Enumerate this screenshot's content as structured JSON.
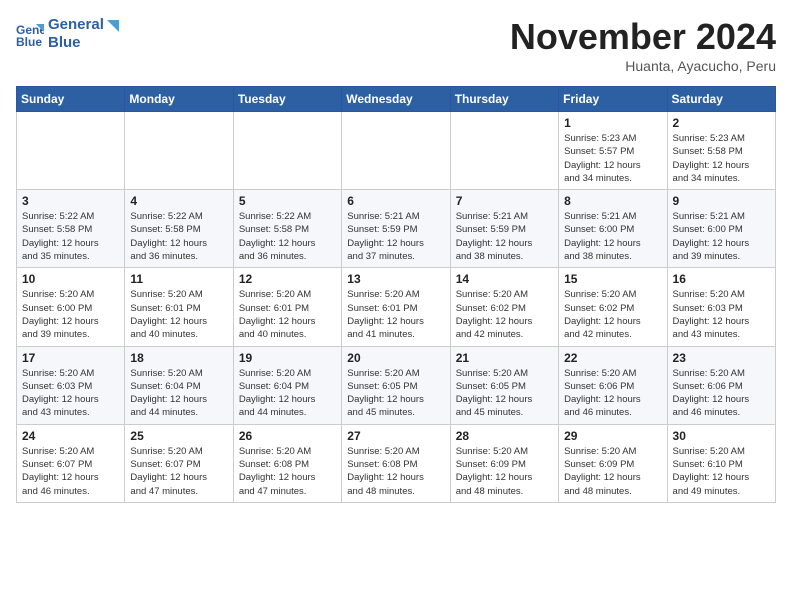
{
  "header": {
    "logo_line1": "General",
    "logo_line2": "Blue",
    "month_year": "November 2024",
    "location": "Huanta, Ayacucho, Peru"
  },
  "days_of_week": [
    "Sunday",
    "Monday",
    "Tuesday",
    "Wednesday",
    "Thursday",
    "Friday",
    "Saturday"
  ],
  "weeks": [
    [
      {
        "day": "",
        "info": ""
      },
      {
        "day": "",
        "info": ""
      },
      {
        "day": "",
        "info": ""
      },
      {
        "day": "",
        "info": ""
      },
      {
        "day": "",
        "info": ""
      },
      {
        "day": "1",
        "info": "Sunrise: 5:23 AM\nSunset: 5:57 PM\nDaylight: 12 hours\nand 34 minutes."
      },
      {
        "day": "2",
        "info": "Sunrise: 5:23 AM\nSunset: 5:58 PM\nDaylight: 12 hours\nand 34 minutes."
      }
    ],
    [
      {
        "day": "3",
        "info": "Sunrise: 5:22 AM\nSunset: 5:58 PM\nDaylight: 12 hours\nand 35 minutes."
      },
      {
        "day": "4",
        "info": "Sunrise: 5:22 AM\nSunset: 5:58 PM\nDaylight: 12 hours\nand 36 minutes."
      },
      {
        "day": "5",
        "info": "Sunrise: 5:22 AM\nSunset: 5:58 PM\nDaylight: 12 hours\nand 36 minutes."
      },
      {
        "day": "6",
        "info": "Sunrise: 5:21 AM\nSunset: 5:59 PM\nDaylight: 12 hours\nand 37 minutes."
      },
      {
        "day": "7",
        "info": "Sunrise: 5:21 AM\nSunset: 5:59 PM\nDaylight: 12 hours\nand 38 minutes."
      },
      {
        "day": "8",
        "info": "Sunrise: 5:21 AM\nSunset: 6:00 PM\nDaylight: 12 hours\nand 38 minutes."
      },
      {
        "day": "9",
        "info": "Sunrise: 5:21 AM\nSunset: 6:00 PM\nDaylight: 12 hours\nand 39 minutes."
      }
    ],
    [
      {
        "day": "10",
        "info": "Sunrise: 5:20 AM\nSunset: 6:00 PM\nDaylight: 12 hours\nand 39 minutes."
      },
      {
        "day": "11",
        "info": "Sunrise: 5:20 AM\nSunset: 6:01 PM\nDaylight: 12 hours\nand 40 minutes."
      },
      {
        "day": "12",
        "info": "Sunrise: 5:20 AM\nSunset: 6:01 PM\nDaylight: 12 hours\nand 40 minutes."
      },
      {
        "day": "13",
        "info": "Sunrise: 5:20 AM\nSunset: 6:01 PM\nDaylight: 12 hours\nand 41 minutes."
      },
      {
        "day": "14",
        "info": "Sunrise: 5:20 AM\nSunset: 6:02 PM\nDaylight: 12 hours\nand 42 minutes."
      },
      {
        "day": "15",
        "info": "Sunrise: 5:20 AM\nSunset: 6:02 PM\nDaylight: 12 hours\nand 42 minutes."
      },
      {
        "day": "16",
        "info": "Sunrise: 5:20 AM\nSunset: 6:03 PM\nDaylight: 12 hours\nand 43 minutes."
      }
    ],
    [
      {
        "day": "17",
        "info": "Sunrise: 5:20 AM\nSunset: 6:03 PM\nDaylight: 12 hours\nand 43 minutes."
      },
      {
        "day": "18",
        "info": "Sunrise: 5:20 AM\nSunset: 6:04 PM\nDaylight: 12 hours\nand 44 minutes."
      },
      {
        "day": "19",
        "info": "Sunrise: 5:20 AM\nSunset: 6:04 PM\nDaylight: 12 hours\nand 44 minutes."
      },
      {
        "day": "20",
        "info": "Sunrise: 5:20 AM\nSunset: 6:05 PM\nDaylight: 12 hours\nand 45 minutes."
      },
      {
        "day": "21",
        "info": "Sunrise: 5:20 AM\nSunset: 6:05 PM\nDaylight: 12 hours\nand 45 minutes."
      },
      {
        "day": "22",
        "info": "Sunrise: 5:20 AM\nSunset: 6:06 PM\nDaylight: 12 hours\nand 46 minutes."
      },
      {
        "day": "23",
        "info": "Sunrise: 5:20 AM\nSunset: 6:06 PM\nDaylight: 12 hours\nand 46 minutes."
      }
    ],
    [
      {
        "day": "24",
        "info": "Sunrise: 5:20 AM\nSunset: 6:07 PM\nDaylight: 12 hours\nand 46 minutes."
      },
      {
        "day": "25",
        "info": "Sunrise: 5:20 AM\nSunset: 6:07 PM\nDaylight: 12 hours\nand 47 minutes."
      },
      {
        "day": "26",
        "info": "Sunrise: 5:20 AM\nSunset: 6:08 PM\nDaylight: 12 hours\nand 47 minutes."
      },
      {
        "day": "27",
        "info": "Sunrise: 5:20 AM\nSunset: 6:08 PM\nDaylight: 12 hours\nand 48 minutes."
      },
      {
        "day": "28",
        "info": "Sunrise: 5:20 AM\nSunset: 6:09 PM\nDaylight: 12 hours\nand 48 minutes."
      },
      {
        "day": "29",
        "info": "Sunrise: 5:20 AM\nSunset: 6:09 PM\nDaylight: 12 hours\nand 48 minutes."
      },
      {
        "day": "30",
        "info": "Sunrise: 5:20 AM\nSunset: 6:10 PM\nDaylight: 12 hours\nand 49 minutes."
      }
    ]
  ]
}
